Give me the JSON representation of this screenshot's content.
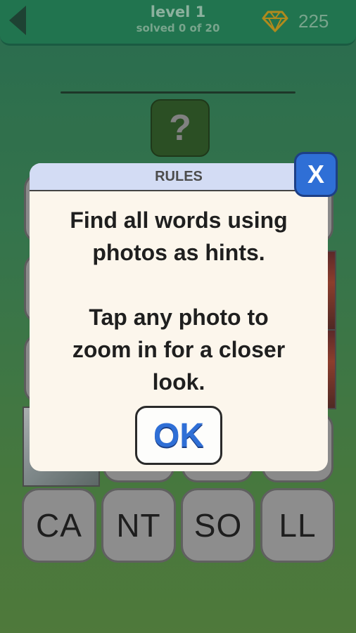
{
  "header": {
    "level_title": "level 1",
    "progress": "solved 0 of 20",
    "gem_count": "225",
    "colors": {
      "bar": "#1f8a5a",
      "gem": "#d7a61a"
    }
  },
  "puzzle": {
    "question_mark": "?"
  },
  "letter_tiles": [
    "CA",
    "NT",
    "SO",
    "LL"
  ],
  "rules_dialog": {
    "title": "RULES",
    "line1": "Find all words using",
    "line2": "photos as hints.",
    "line3": "Tap any photo to",
    "line4": "zoom in for a closer",
    "line5": "look.",
    "ok_label": "OK",
    "close_label": "X",
    "colors": {
      "button": "#2f6fd6",
      "header": "#d3dcf4"
    }
  }
}
